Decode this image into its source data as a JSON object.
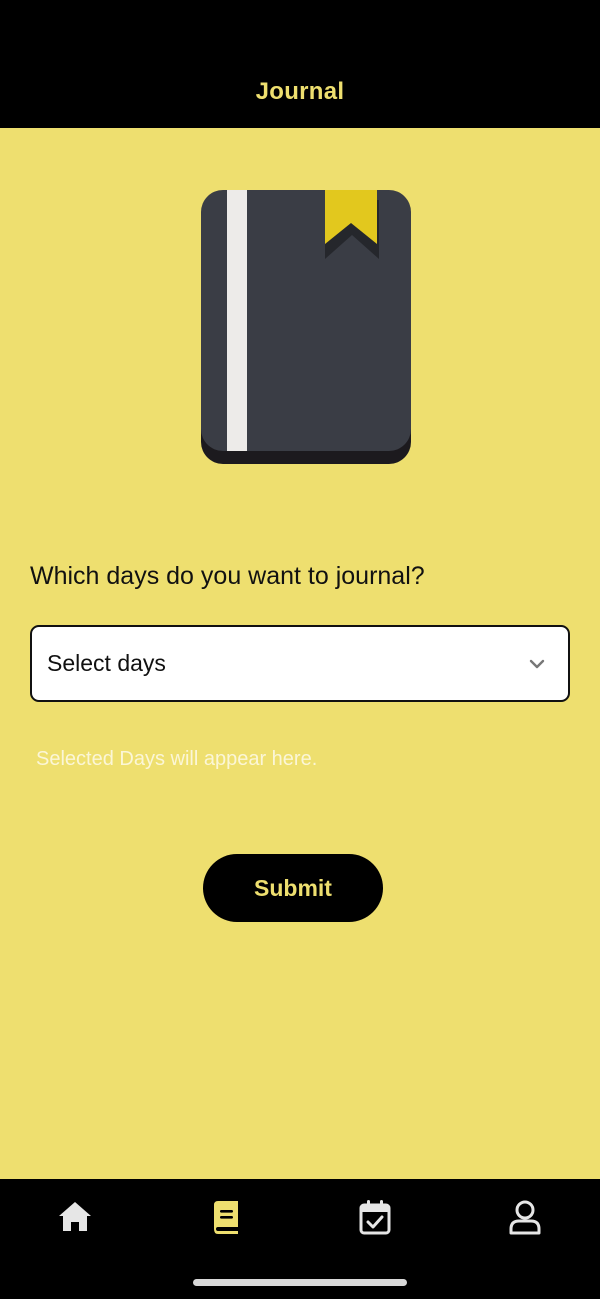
{
  "header": {
    "title": "Journal"
  },
  "illustration": {
    "icon": "journal-book-icon"
  },
  "form": {
    "question": "Which days do you want to journal?",
    "select_placeholder": "Select days",
    "selected_hint": "Selected Days will appear here.",
    "submit_label": "Submit"
  },
  "tabbar": {
    "items": [
      {
        "icon": "home-icon",
        "active": false
      },
      {
        "icon": "journal-icon",
        "active": true
      },
      {
        "icon": "calendar-check-icon",
        "active": false
      },
      {
        "icon": "profile-icon",
        "active": false
      }
    ]
  },
  "colors": {
    "background": "#EEDF6F",
    "bar": "#000000",
    "accent": "#EEDF6F",
    "book_cover": "#3A3D45",
    "bookmark": "#E2C81E"
  }
}
